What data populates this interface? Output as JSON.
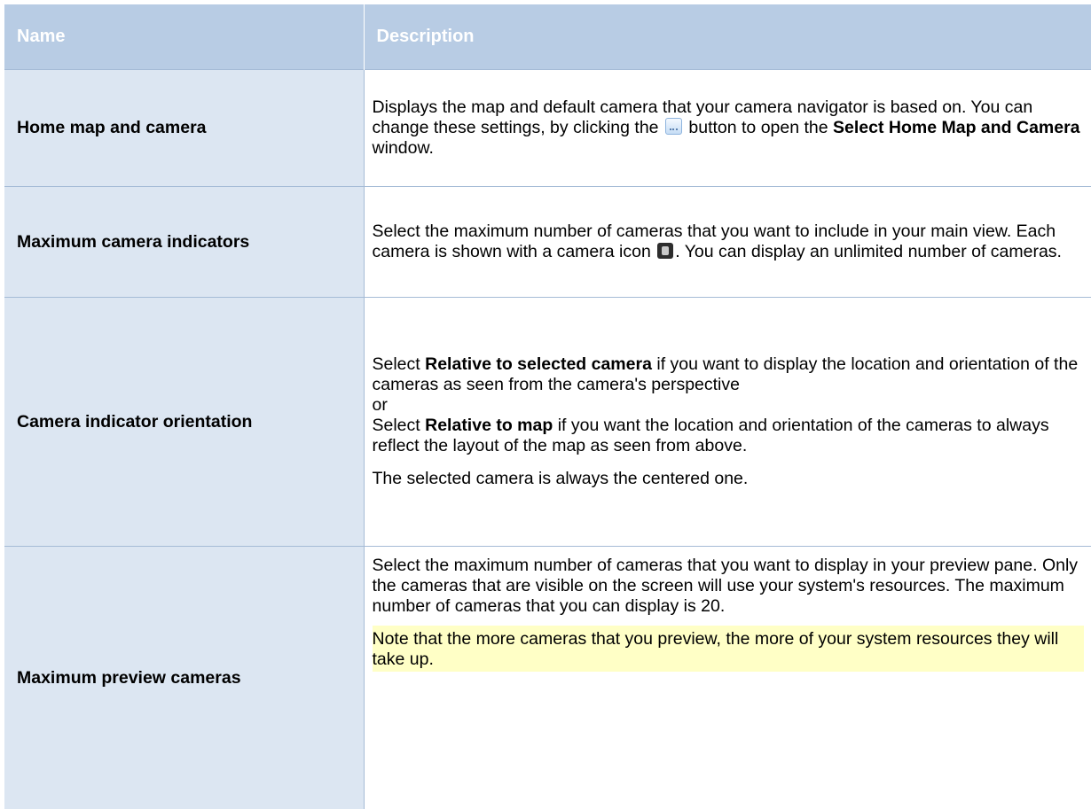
{
  "header": {
    "col_name": "Name",
    "col_description": "Description"
  },
  "rows": [
    {
      "name": "Home map and camera",
      "desc_a": "Displays the map and default camera that your camera navigator is based on. You can change these settings, by clicking the",
      "icon": "ellipsis-button-icon",
      "desc_b": "button to open the",
      "desc_bold": "Select Home Map and Camera",
      "desc_c": "window."
    },
    {
      "name": "Maximum camera indicators",
      "desc_a": "Select the maximum number of cameras that you want to include in your main view. Each camera is shown with a camera icon",
      "icon": "camera-icon",
      "desc_b": ". You can display an unlimited number of cameras."
    },
    {
      "name": "Camera indicator orientation",
      "p1_a": "Select",
      "p1_bold": "Relative to selected camera",
      "p1_b": "if you want to display the location and orientation of the cameras as seen from the camera's perspective",
      "or": "or",
      "p2_a": "Select",
      "p2_bold": "Relative to map",
      "p2_b": "if you want the location and orientation of the cameras to always reflect the layout of the map as seen from above.",
      "p3": "The selected camera is always the centered one."
    },
    {
      "name": "Maximum preview cameras",
      "p1": "Select the maximum number of cameras that you want to display in your preview pane. Only the cameras that are visible on the screen will use your system's resources. The maximum number of cameras that you can display is 20.",
      "note": "Note that the more cameras that you preview, the more of your system resources they will take up."
    }
  ],
  "colors": {
    "header_bg": "#b8cce4",
    "name_cell_bg": "#dce6f2",
    "note_bg": "#ffffc6"
  }
}
